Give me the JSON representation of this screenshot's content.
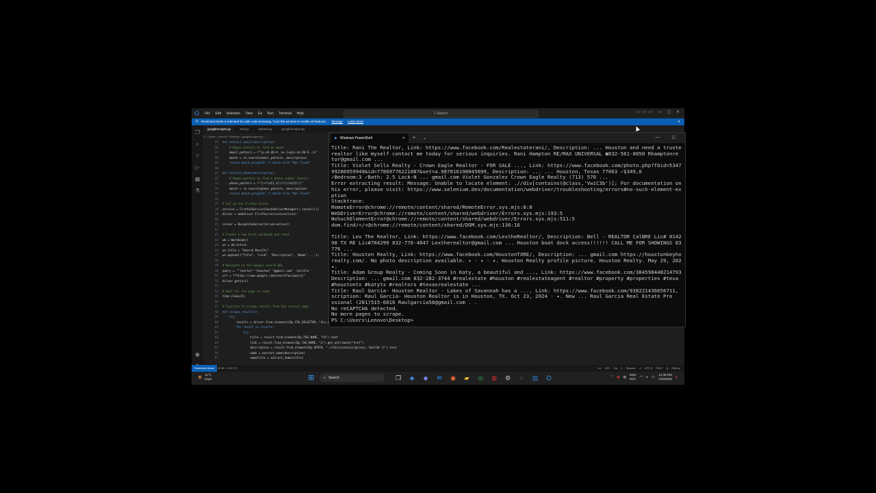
{
  "vscode": {
    "menu": [
      "File",
      "Edit",
      "Selection",
      "View",
      "Go",
      "Run",
      "Terminal",
      "Help"
    ],
    "search_placeholder": "Search",
    "banner": {
      "text": "Restricted Mode is intended for safe code browsing. Trust this window to enable all features.",
      "manage": "Manage",
      "learn_more": "Learn More"
    },
    "tabs": [
      "googlescraper.py",
      "test.py",
      "dataset.py",
      "googlescraper.py"
    ],
    "breadcrumb": "C: › Users › Lenovo › Desktop › googlescraper.py › ...",
    "code_lines": [
      {
        "n": "25",
        "t": "def extract_email(description):"
      },
      {
        "n": "26",
        "t": "    # Regex pattern to find an email"
      },
      {
        "n": "27",
        "t": "    email_pattern = r\"[a-zA-Z0-9._%+-]+@[a-zA-Z0-9.-]+\""
      },
      {
        "n": "28",
        "t": "    match = re.search(email_pattern, description)"
      },
      {
        "n": "29",
        "t": "    return match.group(0) if match else \"Not found\""
      },
      {
        "n": "30",
        "t": ""
      },
      {
        "n": "31",
        "t": "def extract_phone(description):"
      },
      {
        "n": "32",
        "t": "    # Regex pattern to find a phone number (basic)"
      },
      {
        "n": "33",
        "t": "    phone_pattern = r\"(\\+?\\d{1,3})?(\\(\\d{3}\\))\""
      },
      {
        "n": "34",
        "t": "    match = re.search(phone_pattern, description)"
      },
      {
        "n": "35",
        "t": "    return match.group(0) if match else \"Not found\""
      },
      {
        "n": "36",
        "t": ""
      },
      {
        "n": "37",
        "t": "# Set up the Firefox driver"
      },
      {
        "n": "38",
        "t": "service = FirefoxService(GeckoDriverManager().install())"
      },
      {
        "n": "39",
        "t": "driver = webdriver.Firefox(service=service)"
      },
      {
        "n": "40",
        "t": ""
      },
      {
        "n": "41",
        "t": "solver = RecaptchaSolver(driver=driver)"
      },
      {
        "n": "42",
        "t": ""
      },
      {
        "n": "43",
        "t": "# Create a new Excel workbook and sheet"
      },
      {
        "n": "44",
        "t": "wb = Workbook()"
      },
      {
        "n": "45",
        "t": "ws = wb.active"
      },
      {
        "n": "46",
        "t": "ws.title = \"Search Results\""
      },
      {
        "n": "47",
        "t": "ws.append([\"Title\", \"Link\", \"Description\", \"Name\", ...])"
      },
      {
        "n": "48",
        "t": ""
      },
      {
        "n": "49",
        "t": "# Navigate to the Google search URL"
      },
      {
        "n": "50",
        "t": "query = '\"realtor\" \"houston\" \"@gmail.com\" -intitle'"
      },
      {
        "n": "51",
        "t": "url = f\"https://www.google.com/search?q={query}\""
      },
      {
        "n": "52",
        "t": "driver.get(url)"
      },
      {
        "n": "53",
        "t": ""
      },
      {
        "n": "54",
        "t": "# Wait for the page to load"
      },
      {
        "n": "55",
        "t": "time.sleep(5)"
      },
      {
        "n": "56",
        "t": ""
      },
      {
        "n": "57",
        "t": "# Function to scrape results from the current page"
      },
      {
        "n": "58",
        "t": "def scrape_results():"
      },
      {
        "n": "59",
        "t": "    try:"
      },
      {
        "n": "60",
        "t": "        results = driver.find_elements(By.CSS_SELECTOR, \"div.g\")  # Locate search result containers"
      },
      {
        "n": "61",
        "t": "        for result in results:"
      },
      {
        "n": "62",
        "t": "            try:"
      },
      {
        "n": "63",
        "t": "                title = result.find_element(By.TAG_NAME, \"h3\").text"
      },
      {
        "n": "64",
        "t": "                link = result.find_element(By.TAG_NAME, \"a\").get_attribute(\"href\")"
      },
      {
        "n": "65",
        "t": "                description = result.find_element(By.XPATH, \".//div[contains(@class,'VwiC3b')]\").text"
      },
      {
        "n": "66",
        "t": "                name = extract_name(description)"
      },
      {
        "n": "67",
        "t": "                nametitle = extract_name(title)"
      }
    ],
    "status": {
      "restricted": "Restricted Mode",
      "problems": "⊗ 68 ⚠ 113",
      "ports": "⚲ 0",
      "position": "Ln 102, Col 1",
      "spaces": "Spaces: 4",
      "encoding": "UTF-8",
      "eol": "CRLF",
      "language": "{} Python"
    }
  },
  "powershell": {
    "tab_title": "Windows PowerShell",
    "lines": [
      "Title: Rani The Realtor, Link: https://www.facebook.com/Realestaterani/, Description: ... Houston and need a truste",
      "realtor like myself contact me today for serious inquiries. Rani Hampton RE/MAX UNIVERSAL ☎832-561-8050 Rhamptonre",
      "tor@gmail.com ...",
      "Title: Violet Sells Realty - Crown Eagle Realtor - FOR SALE ..., Link: https://www.facebook.com/photo.php?fbid=5347",
      "99286959949&id=77869776221087&set=a.987016198045699, Description: ... ... Houston, Texas 77063 ✓$349,0",
      " ✓Bedroom:3 ✓Bath: 2.5 Lock-N ... gmail.com Violet Gonzalez Crown Eagle Realty (713) 570 ...",
      "Error extracting result: Message: Unable to locate element: .//div[contains(@class,'VwiC3b')]; For documentation on",
      "his error, please visit: https://www.selenium.dev/documentation/webdriver/troubleshooting/errors#no-such-element-ex",
      "ption",
      "Stacktrace:",
      "RemoteError@chrome://remote/content/shared/RemoteError.sys.mjs:8:8",
      "WebDriverError@chrome://remote/content/shared/webdriver/Errors.sys.mjs:193:5",
      "NoSuchElementError@chrome://remote/content/shared/webdriver/Errors.sys.mjs:511:5",
      "dom.find/</<@chrome://remote/content/shared/DOM.sys.mjs:136:16",
      "",
      "Title: Lex The Realtor, Link: https://www.facebook.com/LextheRealtor/, Description: Bell - REALTOR CalBRE Lic# 0142",
      "98 TX RE Lic#784299 832-776-4847 Lextherealtor@gmail.com ... Houston boat dock access!!!!!! CALL ME FOR SHOWINGS 83",
      "776 ...",
      "Title: Houston Realty, Link: https://www.facebook.com/HoustonTXRE/, Description: ... gmail.com https://houstonkeyho",
      "realty.com/. No photo description available. ✦ · ✦ · ✦. Houston Realty profile picture. Houston Realty. May 29, 202",
      "✦.",
      "Title: Adam Group Realty - Coming Soon in Katy, a beautiful and ..., Link: https://www.facebook.com/384598448214793",
      " Description: ... gmail.com 832-282-3744 #realestate #houston #realestateagent #realtor #property #properties #texa",
      "#houstontx #katytx #realtors #texasrealestate ...",
      "Title: Raul Garcia- Houston Realtor - Lakes of Savannah has a ..., Link: https://www.facebook.com/938221436656711,",
      "scription: Raul Garcia- Houston Realtor is in Houston, TX. Oct 23, 2024 · ✦. New ... Raul Garcia Real Estate Pro",
      "ssional (281)515-6816 Raulgarcia56@gmail.com . .",
      "No reCAPTCHA detected.",
      "No more pages to scrape.",
      "PS C:\\Users\\Lenovo\\Desktop>"
    ]
  },
  "taskbar": {
    "weather_temp": "11°C",
    "weather_cond": "Haze",
    "search_label": "Search",
    "lang_top": "ENG",
    "lang_bottom": "INTL",
    "time": "12:38 PM",
    "date": "1/19/2025"
  }
}
